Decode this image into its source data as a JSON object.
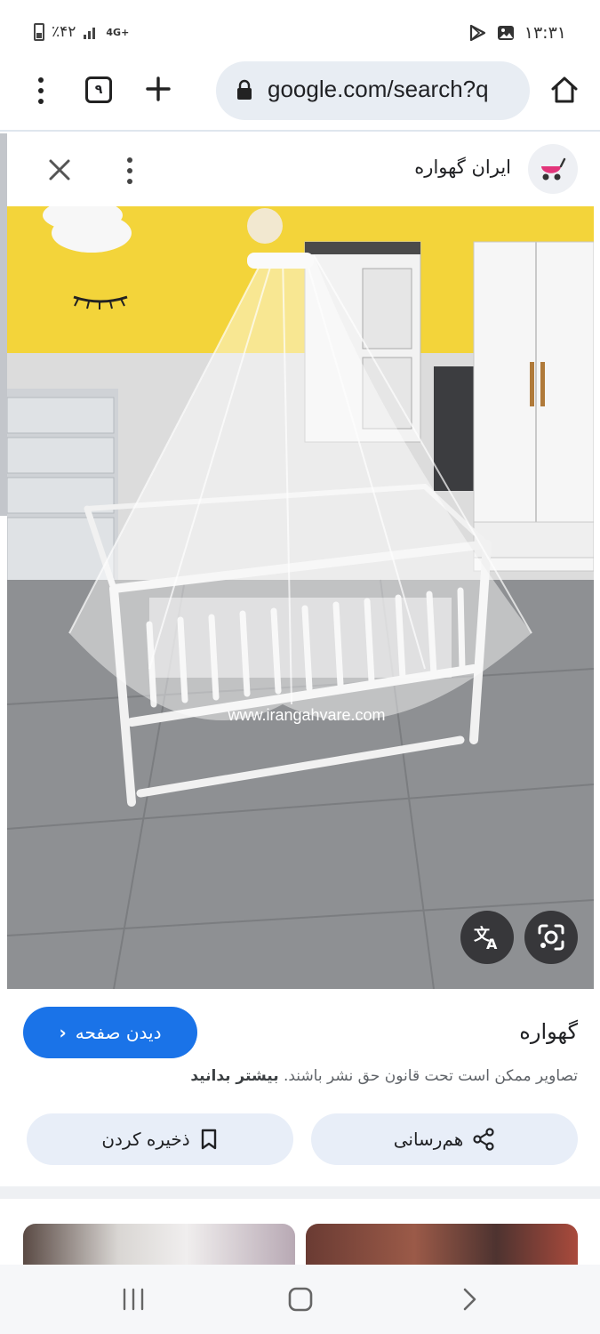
{
  "status_bar": {
    "battery": "٪۴۲",
    "network": "4G+",
    "time": "۱۳:۳۱"
  },
  "toolbar": {
    "tab_count": "۹",
    "url": "google.com/search?q"
  },
  "source": {
    "name": "ایران گهواره"
  },
  "image": {
    "watermark": "www.irangahvare.com"
  },
  "result": {
    "title": "گهواره",
    "visit_label": "دیدن صفحه",
    "copyright_text": "تصاویر ممکن است تحت قانون حق نشر باشند.",
    "learn_more": "بیشتر بدانید",
    "share_label": "هم‌رسانی",
    "save_label": "ذخیره کردن"
  },
  "colors": {
    "accent": "#1a73e8",
    "pill": "#e8eef8",
    "url_bar": "#e8edf3"
  }
}
